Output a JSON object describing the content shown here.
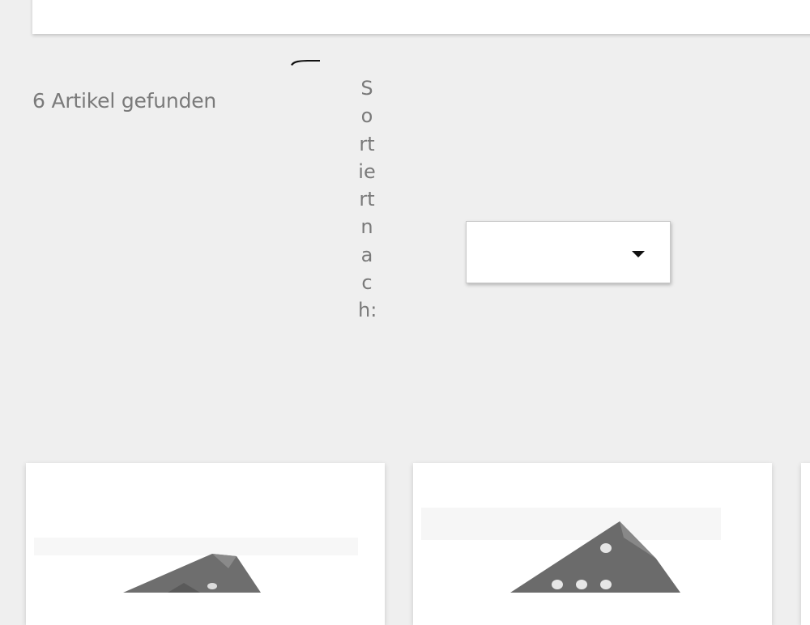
{
  "listing": {
    "result_count_text": "6 Artikel gefunden",
    "sort": {
      "label": "Sortiert nach:",
      "selected_value": ""
    }
  },
  "products": [
    {
      "image_icon": "metal-bracket-image"
    },
    {
      "image_icon": "metal-bracket-image"
    },
    {
      "image_icon": "metal-bracket-image"
    }
  ]
}
